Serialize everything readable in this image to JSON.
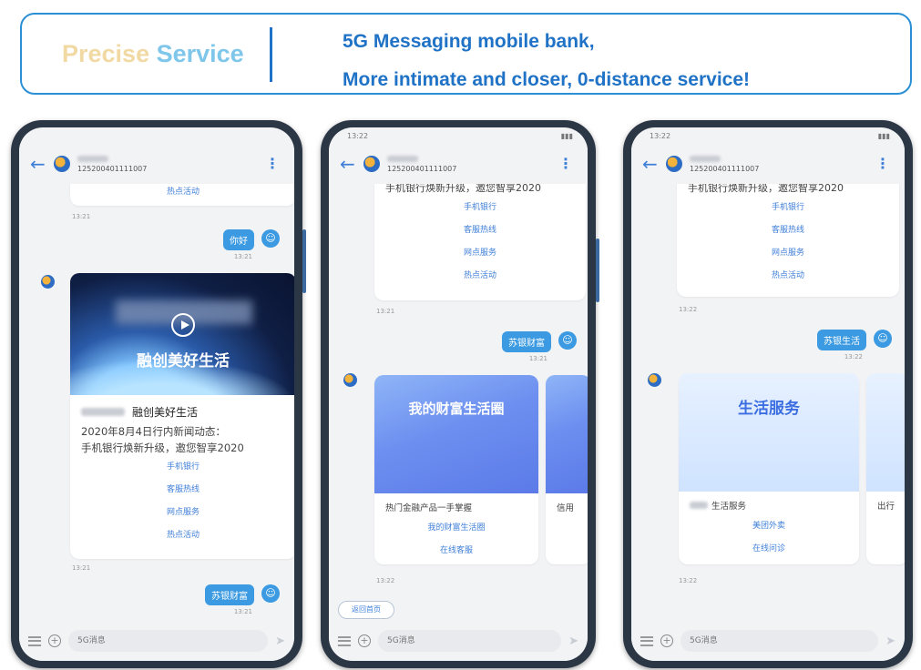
{
  "banner": {
    "left_word1": "Precise",
    "left_word2": "Service",
    "line1": "5G Messaging mobile bank,",
    "line2": "More intimate and closer, 0-distance service!"
  },
  "colors": {
    "accent": "#1f72c6",
    "bubble": "#3b9ae1",
    "link": "#3f7fd8"
  },
  "common": {
    "number": "125200401111007",
    "input_placeholder": "5G消息",
    "links": [
      "手机银行",
      "客服热线",
      "网点服务",
      "热点活动"
    ],
    "card_text_line1": "2020年8月4日行内新闻动态：",
    "card_text_line2": "手机银行焕新升级，邀您智享2020",
    "me_icon": "user-icon",
    "back_icon": "arrow-left-icon",
    "menu_icon": "kebab-icon"
  },
  "phone1": {
    "top_link": "热点活动",
    "time1": "13:21",
    "bubble1": "你好",
    "bubble1_time": "13:21",
    "card_image_title": "融创美好生活",
    "card_title": "融创美好生活",
    "time2": "13:21",
    "bubble2": "苏银财富",
    "bubble2_time": "13:21"
  },
  "phone2": {
    "status_time": "13:22",
    "time1": "13:21",
    "bubble": "苏银财富",
    "bubble_time": "13:21",
    "card_image_title": "我的财富生活圈",
    "card_row": "热门金融产品一手掌握",
    "card_link1": "我的财富生活圈",
    "card_link2": "在线客服",
    "peek_row": "信用",
    "time2": "13:22",
    "back_home": "返回首页"
  },
  "phone3": {
    "status_time": "13:22",
    "time1": "13:22",
    "bubble": "苏银生活",
    "bubble_time": "13:22",
    "card_image_title": "生活服务",
    "card_row": "生活服务",
    "card_link1": "美团外卖",
    "card_link2": "在线问诊",
    "peek_row": "出行",
    "time2": "13:22"
  }
}
